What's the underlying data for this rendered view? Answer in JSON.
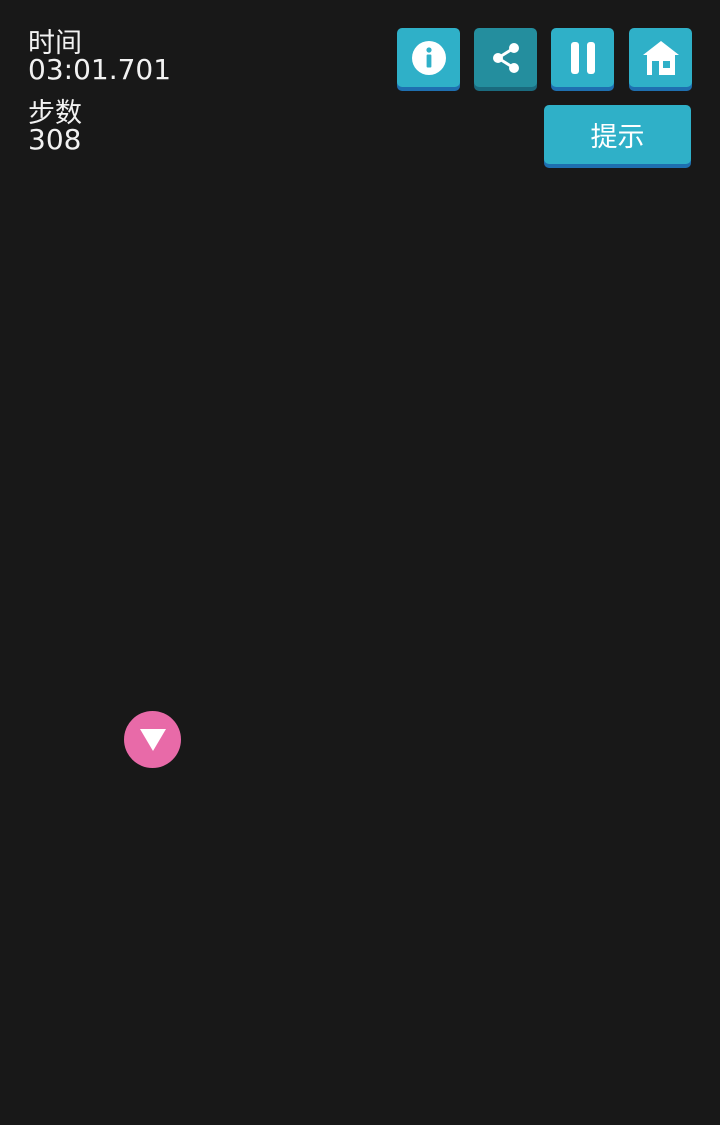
{
  "stats": {
    "time_label": "时间",
    "time_value": "03:01.701",
    "steps_label": "步数",
    "steps_value": "308"
  },
  "toolbar": {
    "hint_label": "提示",
    "icons": {
      "info": "info-icon",
      "share": "share-icon",
      "pause": "pause-icon",
      "home": "home-icon"
    }
  },
  "board": {
    "player_icon": "triangle-down-icon"
  },
  "colors": {
    "background": "#181818",
    "button": "#2fb0c8",
    "button_shadow": "#1e6fb0",
    "player": "#e86aa8",
    "text": "#f2f2f2"
  }
}
